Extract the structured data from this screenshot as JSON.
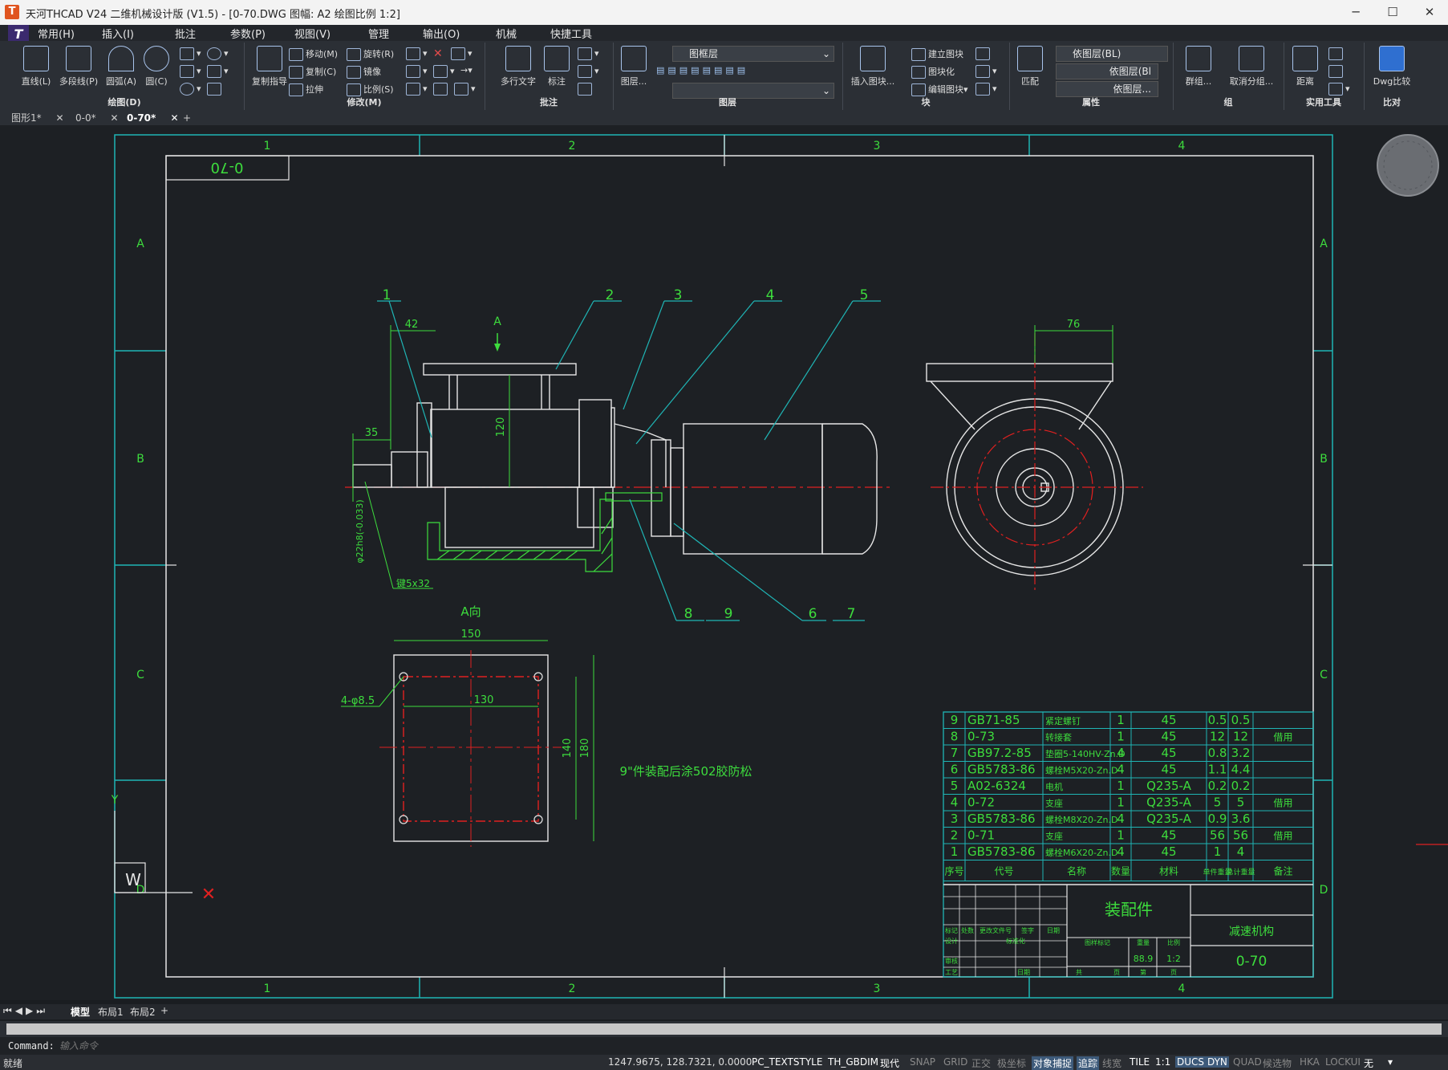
{
  "window": {
    "app_logo": "T",
    "title": "天河THCAD V24 二维机械设计版 (V1.5) - [0-70.DWG 图幅: A2 绘图比例 1:2]",
    "minimize": "─",
    "maximize": "☐",
    "close": "✕"
  },
  "menu": {
    "app_icon": "T",
    "items": [
      "常用(H)",
      "插入(I)",
      "批注",
      "参数(P)",
      "视图(V)",
      "管理",
      "输出(O)",
      "机械",
      "快捷工具"
    ]
  },
  "ribbon": {
    "draw": {
      "label": "绘图(D)",
      "line": "直线(L)",
      "polyline": "多段线(P)",
      "arc": "圆弧(A)",
      "circle": "圆(C)"
    },
    "modify": {
      "label": "修改(M)",
      "copy_guide": "复制指导",
      "move": "移动(M)",
      "copy": "复制(C)",
      "stretch": "拉伸",
      "rotate": "旋转(R)",
      "mirror": "镜像",
      "scale": "比例(S)"
    },
    "annotate": {
      "label": "批注",
      "mtext": "多行文字",
      "dimension": "标注"
    },
    "layers": {
      "label": "图层",
      "layer_btn": "图层...",
      "current_layer": "图框层"
    },
    "block": {
      "label": "块",
      "insert": "插入图块...",
      "create": "建立图块",
      "blockify": "图块化",
      "edit": "编辑图块"
    },
    "properties": {
      "label": "属性",
      "match": "匹配",
      "color": "依图层(BL)",
      "linetype": "依图层(Bl",
      "lineweight": "依图层..."
    },
    "group": {
      "label": "组",
      "group": "群组...",
      "ungroup": "取消分组..."
    },
    "utilities": {
      "label": "实用工具",
      "distance": "距离"
    },
    "compare": {
      "label": "比对",
      "dwg_compare": "Dwg比较"
    }
  },
  "doc_tabs": [
    {
      "label": "图形1*",
      "close": "✕"
    },
    {
      "label": "0-0*",
      "close": "✕"
    },
    {
      "label": "0-70*",
      "close": "✕",
      "active": true
    }
  ],
  "add_tab": "+",
  "drawing": {
    "zones_top": [
      "1",
      "2",
      "3",
      "4"
    ],
    "zones_side": [
      "A",
      "B",
      "C",
      "D"
    ],
    "drawing_no_mirrored": "0-70",
    "balloons": [
      "1",
      "2",
      "3",
      "4",
      "5",
      "8",
      "9",
      "6",
      "7"
    ],
    "dims": {
      "d42": "42",
      "d120": "120",
      "d35": "35",
      "shaft": "φ22h8(-0.033)",
      "keyway": "键5x32",
      "d76": "76",
      "d150": "150",
      "d130": "130",
      "d140": "140",
      "d180": "180",
      "holes": "4-φ8.5"
    },
    "view_arrow": "A",
    "view_label": "A向",
    "note": "9\"件装配后涂502胶防松",
    "ucs_w": "W",
    "ucs_y": "Y"
  },
  "bom": {
    "rows": [
      [
        "9",
        "GB71-85",
        "紧定螺钉",
        "1",
        "45",
        "0.5",
        "0.5",
        ""
      ],
      [
        "8",
        "0-73",
        "转接套",
        "1",
        "45",
        "12",
        "12",
        "借用"
      ],
      [
        "7",
        "GB97.2-85",
        "垫圈5-140HV-Zn.D",
        "4",
        "45",
        "0.8",
        "3.2",
        ""
      ],
      [
        "6",
        "GB5783-86",
        "螺栓M5X20-Zn.D",
        "4",
        "45",
        "1.1",
        "4.4",
        ""
      ],
      [
        "5",
        "A02-6324",
        "电机",
        "1",
        "Q235-A",
        "0.2",
        "0.2",
        ""
      ],
      [
        "4",
        "0-72",
        "支座",
        "1",
        "Q235-A",
        "5",
        "5",
        "借用"
      ],
      [
        "3",
        "GB5783-86",
        "螺栓M8X20-Zn.D",
        "4",
        "Q235-A",
        "0.9",
        "3.6",
        ""
      ],
      [
        "2",
        "0-71",
        "支座",
        "1",
        "45",
        "56",
        "56",
        "借用"
      ],
      [
        "1",
        "GB5783-86",
        "螺栓M6X20-Zn.D",
        "4",
        "45",
        "1",
        "4",
        ""
      ]
    ],
    "header": [
      "序号",
      "代号",
      "名称",
      "数量",
      "材料",
      "单件重量",
      "总计重量",
      "备注"
    ],
    "title_block": {
      "type": "装配件",
      "name": "减速机构",
      "number": "0-70",
      "weight": "88.9",
      "scale": "1:2",
      "labels": [
        "标记",
        "处数",
        "更改文件号",
        "签字",
        "日期",
        "设计",
        "标准化",
        "图样标记",
        "重量",
        "比例",
        "审核",
        "工艺",
        "日期",
        "共",
        "页",
        "第",
        "页"
      ]
    }
  },
  "layout_tabs": [
    "模型",
    "布局1",
    "布局2"
  ],
  "layout_add": "+",
  "command": {
    "prompt": "Command:",
    "placeholder": "输入命令"
  },
  "status": {
    "ready": "就绪",
    "coords": "1247.9675, 128.7321, 0.0000",
    "toggles": [
      "PC_TEXTSTYLE",
      "TH_GBDIM",
      "现代",
      "SNAP",
      "GRID",
      "正交",
      "极坐标",
      "对象捕捉",
      "追踪",
      "线宽",
      "TILE",
      "1:1",
      "DUCS",
      "DYN",
      "QUAD",
      "候选物",
      "HKA",
      "LOCKUI",
      "无"
    ]
  },
  "colors": {
    "frame": "#1fb5b5",
    "green_text": "#3ddc3d",
    "red_center": "#e02020",
    "canvas": "#1d2024",
    "white_line": "#e6e6e6"
  }
}
